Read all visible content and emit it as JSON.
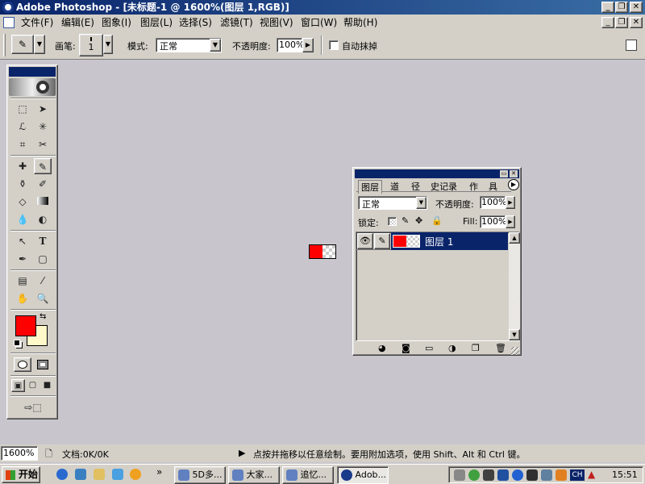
{
  "window": {
    "title": "Adobe Photoshop - [未标题-1 @ 1600%(图层 1,RGB)]"
  },
  "menubar": {
    "items": [
      "文件(F)",
      "编辑(E)",
      "图象(I)",
      "图层(L)",
      "选择(S)",
      "滤镜(T)",
      "视图(V)",
      "窗口(W)",
      "帮助(H)"
    ]
  },
  "options": {
    "brush_label": "画笔:",
    "brush_size": "1",
    "mode_label": "模式:",
    "mode_value": "正常",
    "opacity_label": "不透明度:",
    "opacity_value": "100%",
    "auto_erase_label": "自动抹掉"
  },
  "toolbox": {
    "tools": [
      "marquee-tool",
      "move-tool",
      "lasso-tool",
      "magic-wand-tool",
      "crop-tool",
      "slice-tool",
      "healing-brush-tool",
      "pencil-tool",
      "clone-stamp-tool",
      "history-brush-tool",
      "eraser-tool",
      "gradient-tool",
      "blur-tool",
      "dodge-tool",
      "path-selection-tool",
      "type-tool",
      "pen-tool",
      "shape-tool",
      "notes-tool",
      "eyedropper-tool",
      "hand-tool",
      "zoom-tool"
    ]
  },
  "colors": {
    "foreground": "#ff0000",
    "background": "#fff8c8",
    "title_gradient_start": "#0a246a",
    "selection": "#0a246a"
  },
  "layers_panel": {
    "tabs": [
      "图层",
      "道",
      "径",
      "史记录",
      "作",
      "具"
    ],
    "mode_value": "正常",
    "opacity_label": "不透明度:",
    "opacity_value": "100%",
    "lock_label": "锁定:",
    "fill_label": "Fill:",
    "fill_value": "100%",
    "layers": [
      {
        "name": "图层 1",
        "selected": true
      }
    ]
  },
  "status": {
    "zoom": "1600%",
    "doc_info": "文档:0K/0K",
    "hint": "点按并拖移以任意绘制。要用附加选项，使用 Shift、Alt 和 Ctrl 键。"
  },
  "taskbar": {
    "start_label": "开始",
    "tasks": [
      "5D多...",
      "大家...",
      "追忆...",
      "Adob..."
    ],
    "clock": "15:51",
    "ime_label": "CH"
  }
}
